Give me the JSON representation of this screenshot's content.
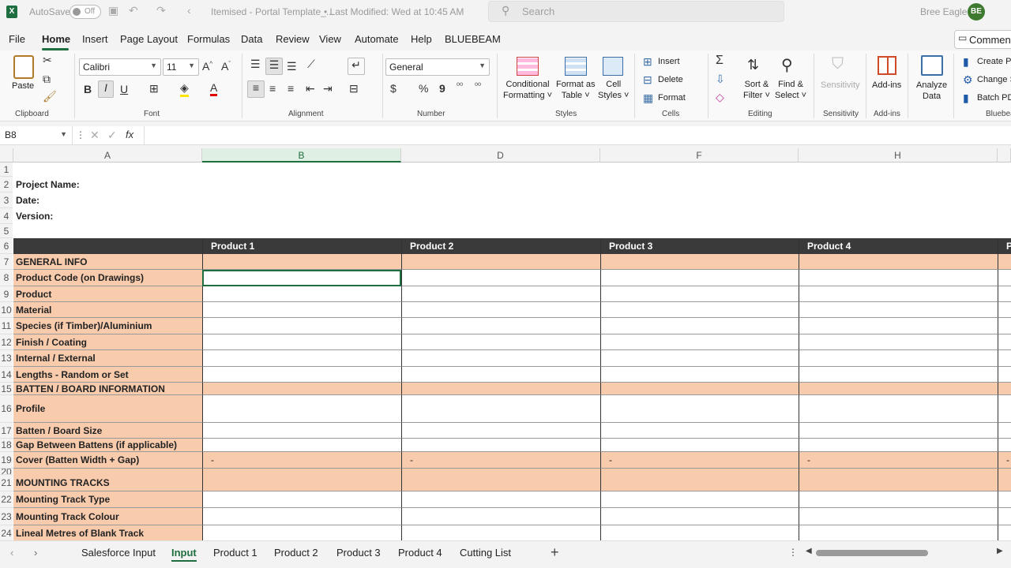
{
  "titlebar": {
    "autosave_label": "AutoSave",
    "autosave_state": "Off",
    "doc_title": "Itemised - Portal Template_...",
    "modified": "• Last Modified: Wed at 10:45 AM",
    "search_placeholder": "Search",
    "user_name": "Bree Eagle",
    "user_initials": "BE"
  },
  "menu": {
    "items": [
      "File",
      "Home",
      "Insert",
      "Page Layout",
      "Formulas",
      "Data",
      "Review",
      "View",
      "Automate",
      "Help",
      "BLUEBEAM"
    ],
    "active": "Home",
    "comments_label": "Comments"
  },
  "ribbon": {
    "clipboard": {
      "paste": "Paste",
      "label": "Clipboard"
    },
    "font": {
      "name": "Calibri",
      "size": "11",
      "label": "Font"
    },
    "alignment": {
      "label": "Alignment"
    },
    "number": {
      "format": "General",
      "label": "Number"
    },
    "styles": {
      "conditional": "Conditional",
      "conditional2": "Formatting",
      "format_as": "Format as",
      "format_as2": "Table",
      "cell": "Cell",
      "cell2": "Styles",
      "label": "Styles"
    },
    "cells": {
      "insert": "Insert",
      "delete": "Delete",
      "format": "Format",
      "label": "Cells"
    },
    "editing": {
      "sort": "Sort &",
      "sort2": "Filter",
      "find": "Find &",
      "find2": "Select",
      "label": "Editing"
    },
    "sensitivity": {
      "btn": "Sensitivity",
      "label": "Sensitivity"
    },
    "addins": {
      "btn": "Add-ins",
      "label": "Add-ins"
    },
    "analyze": {
      "btn": "Analyze",
      "btn2": "Data"
    },
    "bluebeam": {
      "create": "Create PDF",
      "change": "Change Settings",
      "batch": "Batch PDF",
      "label": "Bluebeam"
    }
  },
  "formula_bar": {
    "name_box": "B8",
    "fx": "fx",
    "value": ""
  },
  "grid": {
    "columns": [
      "A",
      "B",
      "D",
      "F",
      "H"
    ],
    "selected_column": "B",
    "header_row": [
      "Product 1",
      "Product 2",
      "Product 3",
      "Product 4",
      "P"
    ],
    "rows": [
      {
        "n": "1",
        "label": ""
      },
      {
        "n": "2",
        "label": "Project Name:"
      },
      {
        "n": "3",
        "label": "Date:"
      },
      {
        "n": "4",
        "label": "Version:"
      },
      {
        "n": "5",
        "label": ""
      },
      {
        "n": "6",
        "label": ""
      },
      {
        "n": "7",
        "label": "GENERAL INFO"
      },
      {
        "n": "8",
        "label": "Product Code (on Drawings)"
      },
      {
        "n": "9",
        "label": "Product"
      },
      {
        "n": "10",
        "label": "Material"
      },
      {
        "n": "11",
        "label": "Species (if Timber)/Aluminium"
      },
      {
        "n": "12",
        "label": "Finish / Coating"
      },
      {
        "n": "13",
        "label": "Internal / External"
      },
      {
        "n": "14",
        "label": "Lengths - Random or Set"
      },
      {
        "n": "15",
        "label": "BATTEN / BOARD INFORMATION"
      },
      {
        "n": "16",
        "label": "Profile"
      },
      {
        "n": "17",
        "label": "Batten / Board Size"
      },
      {
        "n": "18",
        "label": "Gap Between Battens (if applicable)"
      },
      {
        "n": "19",
        "label": "Cover (Batten Width + Gap)"
      },
      {
        "n": "20",
        "label": ""
      },
      {
        "n": "21",
        "label": "MOUNTING TRACKS"
      },
      {
        "n": "22",
        "label": "Mounting Track Type"
      },
      {
        "n": "23",
        "label": "Mounting Track Colour"
      },
      {
        "n": "24",
        "label": "Lineal Metres of Blank Track"
      }
    ],
    "dash": "-"
  },
  "sheets": {
    "tabs": [
      "Salesforce Input",
      "Input",
      "Product 1",
      "Product 2",
      "Product 3",
      "Product 4",
      "Cutting List"
    ],
    "active": "Input"
  },
  "colors": {
    "header_dark": "#3a3a3a",
    "peach": "#f8cbad",
    "accent": "#1e6e3f"
  }
}
